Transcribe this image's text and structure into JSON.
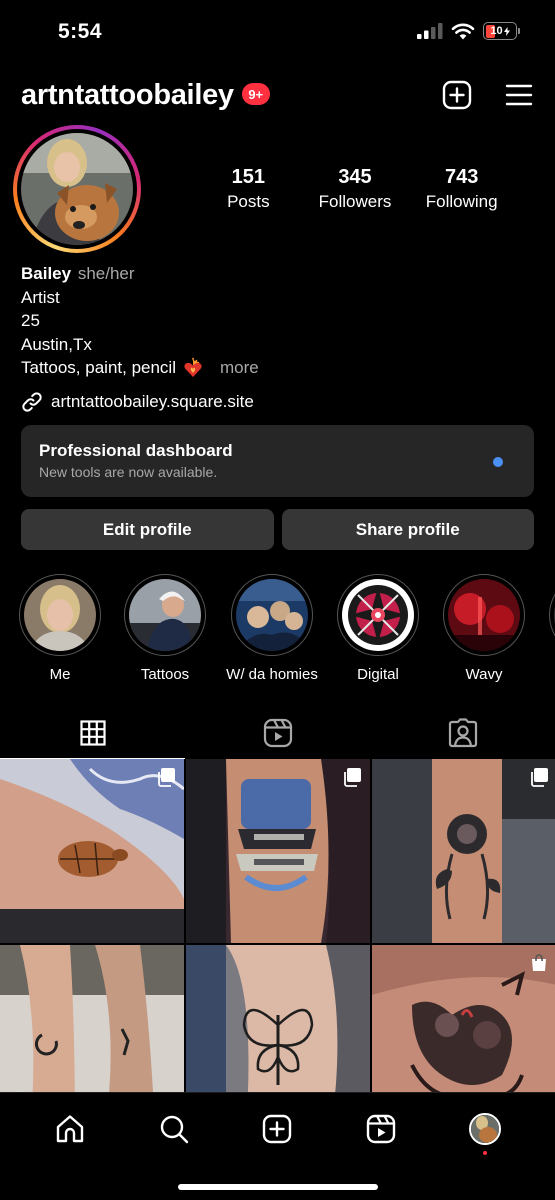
{
  "status_bar": {
    "time": "5:54",
    "battery": "10"
  },
  "header": {
    "username": "artntattoobailey",
    "notification_count": "9+"
  },
  "stats": [
    {
      "value": "151",
      "label": "Posts"
    },
    {
      "value": "345",
      "label": "Followers"
    },
    {
      "value": "743",
      "label": "Following"
    }
  ],
  "bio": {
    "name": "Bailey",
    "pronouns": "she/her",
    "lines": [
      "Artist",
      "25",
      "Austin,Tx",
      "Tattoos, paint, pencil"
    ],
    "more": "more"
  },
  "link": "artntattoobailey.square.site",
  "dashboard": {
    "title": "Professional dashboard",
    "subtitle": "New tools are now available."
  },
  "buttons": {
    "edit": "Edit profile",
    "share": "Share profile"
  },
  "highlights": [
    {
      "label": "Me"
    },
    {
      "label": "Tattoos"
    },
    {
      "label": "W/ da homies"
    },
    {
      "label": "Digital"
    },
    {
      "label": "Wavy"
    }
  ],
  "tabs": [
    "posts-grid",
    "reels",
    "tagged"
  ],
  "grid_icons": [
    "multi-post-icon",
    "multi-post-icon",
    "multi-post-icon",
    "none",
    "none",
    "shop-bag-icon"
  ],
  "colors": {
    "badge": "#ff3040",
    "dashboard_bg": "#262626",
    "button_bg": "#363636",
    "dot": "#4a90f5"
  }
}
